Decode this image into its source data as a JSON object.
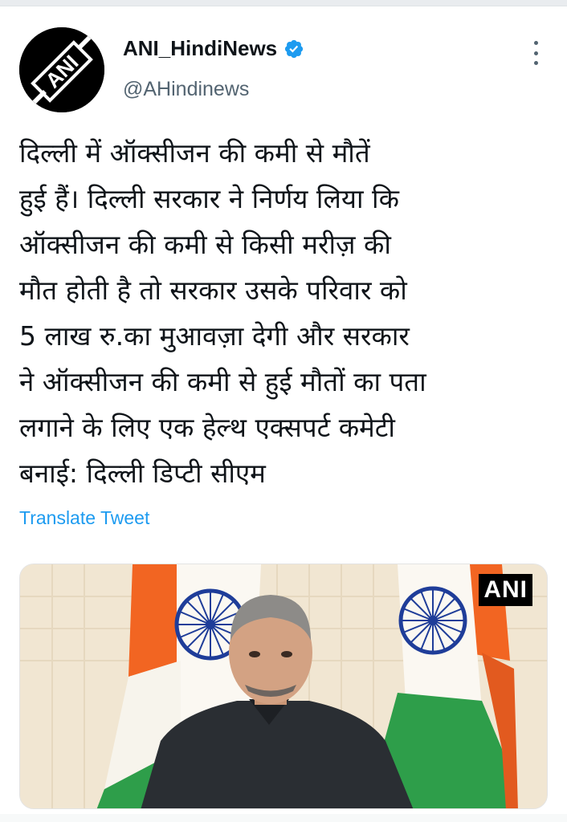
{
  "account": {
    "display_name": "ANI_HindiNews",
    "handle": "@AHindinews",
    "avatar_logo_text": "ANI",
    "verified": true
  },
  "tweet": {
    "text": "दिल्ली में ऑक्सीजन की कमी से मौतें\nहुई हैं। दिल्ली सरकार ने निर्णय लिया कि\nऑक्सीजन की कमी से किसी मरीज़ की\nमौत होती है तो सरकार उसके परिवार को\n5 लाख रु.का मुआवज़ा देगी और सरकार\nने ऑक्सीजन की कमी से हुई मौतों का पता\nलगाने के लिए एक हेल्थ एक्सपर्ट कमेटी\nबनाई: दिल्ली डिप्टी सीएम",
    "translate_label": "Translate Tweet"
  },
  "media": {
    "watermark": "ANI"
  },
  "icons": {
    "verified": "verified-badge-icon",
    "more": "more-options-icon"
  },
  "colors": {
    "accent": "#1d9bf0",
    "secondary_text": "#536471",
    "primary_text": "#0f1419",
    "saffron": "#f26522",
    "green": "#2e9e4a",
    "chakra": "#1f3d99"
  }
}
